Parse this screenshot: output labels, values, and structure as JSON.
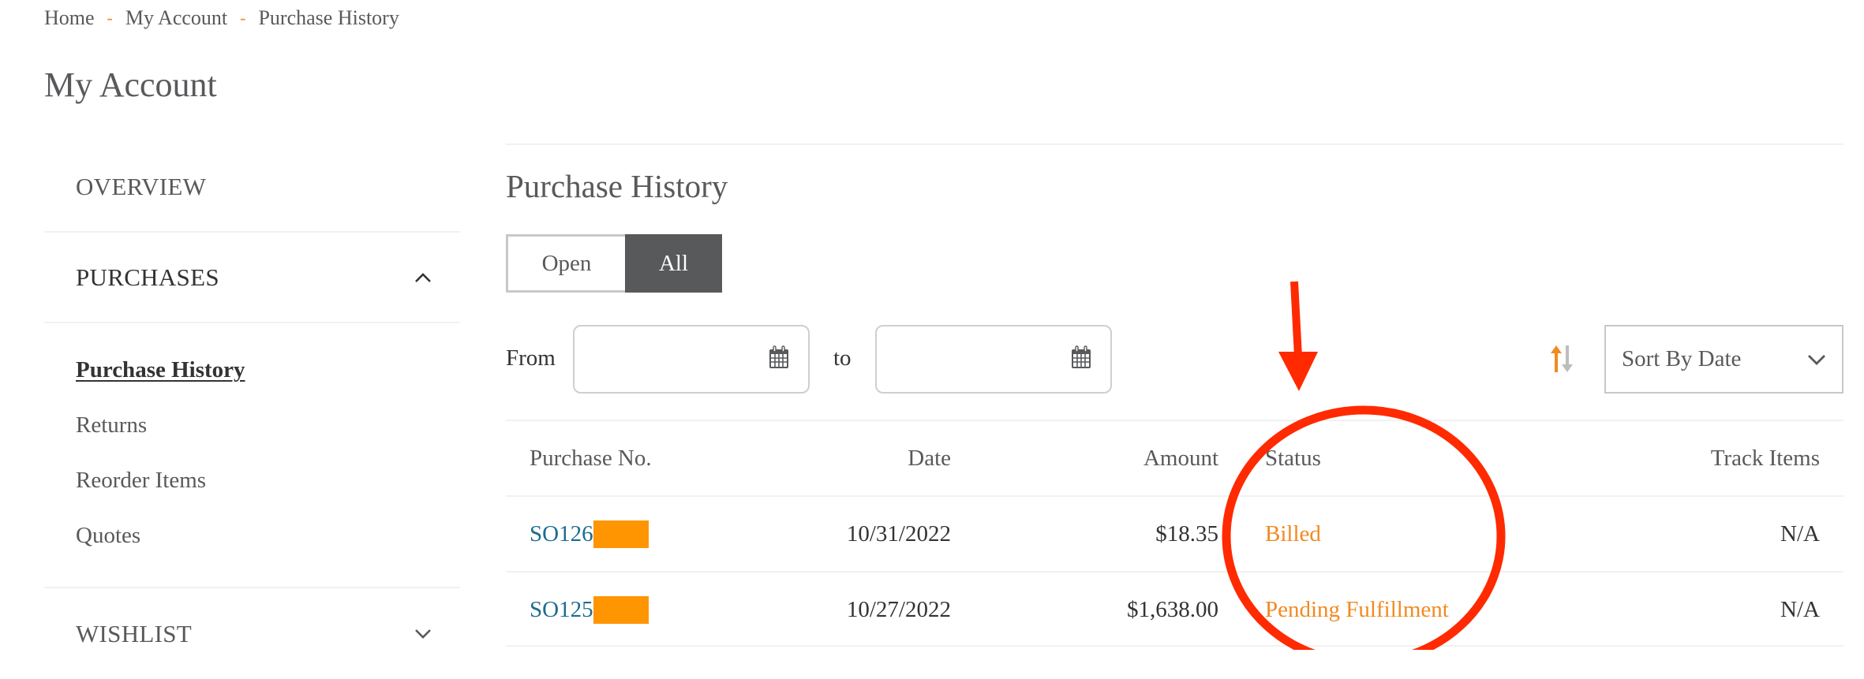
{
  "breadcrumb": [
    {
      "label": "Home"
    },
    {
      "label": "My Account"
    },
    {
      "label": "Purchase History"
    }
  ],
  "breadcrumb_separator": "-",
  "page_title": "My Account",
  "sidebar": {
    "sections": [
      {
        "label": "OVERVIEW",
        "expandable": false
      },
      {
        "label": "PURCHASES",
        "expandable": true,
        "expanded": true,
        "chevron": "chevron-up-icon",
        "items": [
          {
            "label": "Purchase History",
            "current": true
          },
          {
            "label": "Returns"
          },
          {
            "label": "Reorder Items"
          },
          {
            "label": "Quotes"
          }
        ]
      },
      {
        "label": "WISHLIST",
        "expandable": true,
        "expanded": false,
        "chevron": "chevron-down-icon"
      }
    ]
  },
  "main": {
    "title": "Purchase History",
    "toggle": {
      "options": [
        "Open",
        "All"
      ],
      "selected": "All"
    },
    "filters": {
      "from_label": "From",
      "to_label": "to",
      "from_value": "",
      "to_value": "",
      "calendar_icon": "calendar-icon"
    },
    "sort": {
      "direction_icon": "sort-ascending-descending-icon",
      "selected": "Sort By Date"
    },
    "table": {
      "columns": [
        "Purchase No.",
        "Date",
        "Amount",
        "Status",
        "Track Items"
      ],
      "rows": [
        {
          "purchase_no": "SO126",
          "redacted": true,
          "date": "10/31/2022",
          "amount": "$18.35",
          "status": "Billed",
          "track": "N/A"
        },
        {
          "purchase_no": "SO125",
          "redacted": true,
          "date": "10/27/2022",
          "amount": "$1,638.00",
          "status": "Pending Fulfillment",
          "track": "N/A"
        }
      ]
    }
  },
  "colors": {
    "accent_orange": "#f18a21",
    "link_blue": "#1d6c8e",
    "redaction": "#ff9500",
    "annotation_red": "#ff2a00",
    "toggle_active_bg": "#58595b"
  },
  "annotations": {
    "arrow": "red-arrow-pointing-to-status",
    "ellipse": "red-circle-around-status-column"
  }
}
